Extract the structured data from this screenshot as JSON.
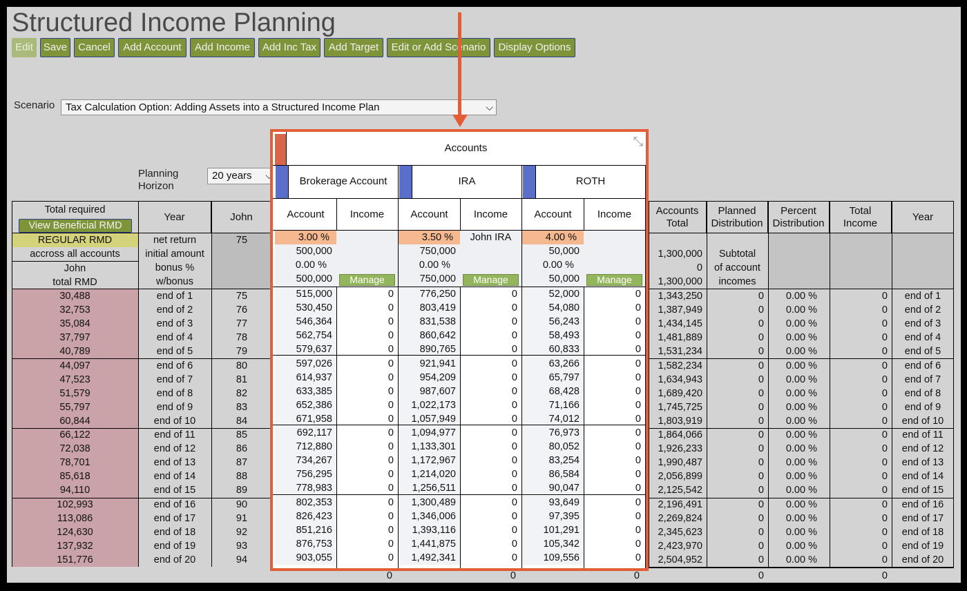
{
  "app": {
    "title": "Structured Income Planning",
    "toolbar": [
      "Edit",
      "Save",
      "Cancel",
      "Add Account",
      "Add Income",
      "Add Inc Tax",
      "Add Target",
      "Edit or Add Scenario",
      "Display Options"
    ],
    "scenario_label": "Scenario",
    "scenario_value": "Tax Calculation Option: Adding Assets into a Structured Income Plan",
    "horizon_label_1": "Planning",
    "horizon_label_2": "Horizon",
    "horizon_value": "20 years"
  },
  "colors": {
    "accent": "#e35d35",
    "button": "#7e9438",
    "rmd_bg": "#c9a3a7",
    "highlight": "#f6b88e",
    "regular_rmd_bg": "#d4d27a",
    "account_marker": "#5a6fc9"
  },
  "icons": {
    "collapse": "collapse-arrows-icon",
    "dropdown": "chevron-down-icon"
  },
  "left": {
    "total_required": "Total required",
    "view_rmd_button": "View Beneficial RMD",
    "regular_rmd": "REGULAR RMD",
    "across": "accross all accounts",
    "john": "John",
    "total_rmd": "total RMD",
    "rmd_values": [
      "30,488",
      "32,753",
      "35,084",
      "37,797",
      "40,789",
      "44,097",
      "47,523",
      "51,579",
      "55,797",
      "60,844",
      "66,122",
      "72,038",
      "78,701",
      "85,618",
      "94,110",
      "102,993",
      "113,086",
      "124,630",
      "137,932",
      "151,776"
    ]
  },
  "year_col": {
    "header": "Year",
    "labels": [
      "net return",
      "initial amount",
      "bonus %",
      "w/bonus"
    ]
  },
  "john_col": {
    "header": "John",
    "first_age": "75"
  },
  "years": [
    "end of 1",
    "end of 2",
    "end of 3",
    "end of 4",
    "end of 5",
    "end of 6",
    "end of 7",
    "end of 8",
    "end of 9",
    "end of 10",
    "end of 11",
    "end of 12",
    "end of 13",
    "end of 14",
    "end of 15",
    "end of 16",
    "end of 17",
    "end of 18",
    "end of 19",
    "end of 20"
  ],
  "ages": [
    "75",
    "76",
    "77",
    "78",
    "79",
    "80",
    "81",
    "82",
    "83",
    "84",
    "85",
    "86",
    "87",
    "88",
    "89",
    "90",
    "91",
    "92",
    "93",
    "94"
  ],
  "panel": {
    "title": "Accounts",
    "account_header": "Account",
    "income_header": "Income",
    "manage_label": "Manage",
    "accounts": [
      {
        "name": "Brokerage Account",
        "net_return": "3.00 %",
        "income_label": "",
        "initial": "500,000",
        "bonus": "0.00 %",
        "w_bonus": "500,000",
        "values": [
          "515,000",
          "530,450",
          "546,364",
          "562,754",
          "579,637",
          "597,026",
          "614,937",
          "633,385",
          "652,386",
          "671,958",
          "692,117",
          "712,880",
          "734,267",
          "756,295",
          "778,983",
          "802,353",
          "826,423",
          "851,216",
          "876,753",
          "903,055"
        ]
      },
      {
        "name": "IRA",
        "net_return": "3.50 %",
        "income_label": "John IRA",
        "initial": "750,000",
        "bonus": "0.00 %",
        "w_bonus": "750,000",
        "values": [
          "776,250",
          "803,419",
          "831,538",
          "860,642",
          "890,765",
          "921,941",
          "954,209",
          "987,607",
          "1,022,173",
          "1,057,949",
          "1,094,977",
          "1,133,301",
          "1,172,967",
          "1,214,020",
          "1,256,511",
          "1,300,489",
          "1,346,006",
          "1,393,116",
          "1,441,875",
          "1,492,341"
        ]
      },
      {
        "name": "ROTH",
        "net_return": "4.00 %",
        "income_label": "",
        "initial": "50,000",
        "bonus": "0.00 %",
        "w_bonus": "50,000",
        "values": [
          "52,000",
          "54,080",
          "56,243",
          "58,493",
          "60,833",
          "63,266",
          "65,797",
          "68,428",
          "71,166",
          "74,012",
          "76,973",
          "80,052",
          "83,254",
          "86,584",
          "90,047",
          "93,649",
          "97,395",
          "101,291",
          "105,342",
          "109,556"
        ]
      }
    ],
    "income_value": "0"
  },
  "right": {
    "headers": [
      "Accounts\nTotal",
      "Planned\nDistribution",
      "Percent\nDistribution",
      "Total\nIncome",
      "Year"
    ],
    "accounts_total_initial": "1,300,000",
    "accounts_total_bonus": "0",
    "accounts_total_wbonus": "1,300,000",
    "subtotal_1": "Subtotal",
    "subtotal_2": "of account",
    "subtotal_3": "incomes",
    "totals": [
      "1,343,250",
      "1,387,949",
      "1,434,145",
      "1,481,889",
      "1,531,234",
      "1,582,234",
      "1,634,943",
      "1,689,420",
      "1,745,725",
      "1,803,919",
      "1,864,066",
      "1,926,233",
      "1,990,487",
      "2,056,899",
      "2,125,542",
      "2,196,491",
      "2,269,824",
      "2,345,623",
      "2,423,970",
      "2,504,952"
    ],
    "planned_value": "0",
    "percent_value": "0.00 %",
    "income_value": "0"
  },
  "footer": {
    "values": [
      "0",
      "0",
      "0",
      "0",
      "0"
    ]
  }
}
